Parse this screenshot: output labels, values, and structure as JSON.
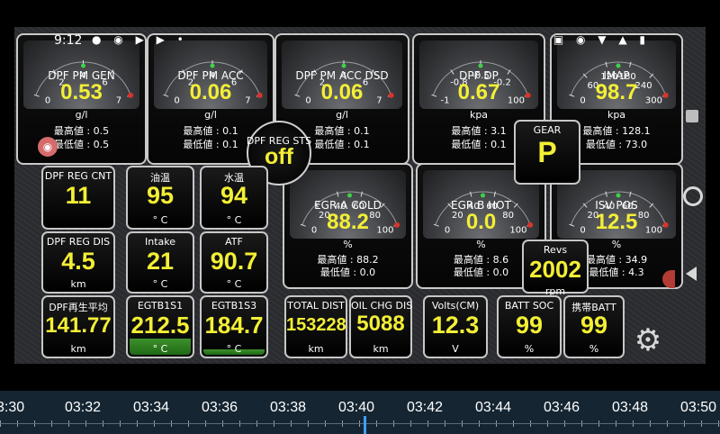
{
  "status_bar": {
    "time": "9:12"
  },
  "gauges": [
    {
      "id": "dpf-pm-gen",
      "title": "DPF PM GEN",
      "value": "0.53",
      "unit": "g/l",
      "ticks": [
        "0",
        "2",
        "4",
        "6",
        "7"
      ],
      "max_label": "最高値 : 0.5",
      "min_label": "最低値 : 0.5"
    },
    {
      "id": "dpf-pm-acc",
      "title": "DPF PM ACC",
      "value": "0.06",
      "unit": "g/l",
      "ticks": [
        "0",
        "2",
        "4",
        "6",
        "7"
      ],
      "max_label": "最高値 : 0.1",
      "min_label": "最低値 : 0.1"
    },
    {
      "id": "dpf-pm-acc-dsd",
      "title": "DPF PM ACC DSD",
      "value": "0.06",
      "unit": "g/l",
      "ticks": [
        "0",
        "2",
        "4",
        "6",
        "7"
      ],
      "max_label": "最高値 : 0.1",
      "min_label": "最低値 : 0.1"
    },
    {
      "id": "dpf-dp",
      "title": "DPF DP",
      "value": "0.67",
      "unit": "kpa",
      "ticks": [
        "-1",
        "-0.8",
        "-0.5",
        "-0.2",
        "100"
      ],
      "max_label": "最高値 : 3.1",
      "min_label": "最低値 : 0.1"
    },
    {
      "id": "imap",
      "title": "IMAP",
      "value": "98.7",
      "unit": "kpa",
      "ticks": [
        "0",
        "60",
        "120",
        "180",
        "240",
        "300"
      ],
      "max_label": "最高値 : 128.1",
      "min_label": "最低値 : 73.0"
    },
    {
      "id": "egr-a-cold",
      "title": "EGR A COLD",
      "value": "88.2",
      "unit": "%",
      "ticks": [
        "0",
        "20",
        "40",
        "60",
        "80",
        "100"
      ],
      "max_label": "最高値 : 88.2",
      "min_label": "最低値 : 0.0"
    },
    {
      "id": "egr-b-hot",
      "title": "EGR B HOT",
      "value": "0.0",
      "unit": "%",
      "ticks": [
        "0",
        "20",
        "40",
        "60",
        "80",
        "100"
      ],
      "max_label": "最高値 : 8.6",
      "min_label": "最低値 : 0.0"
    },
    {
      "id": "isv-pos",
      "title": "ISV POS",
      "value": "12.5",
      "unit": "%",
      "ticks": [
        "0",
        "20",
        "40",
        "60",
        "80",
        "100"
      ],
      "max_label": "最高値 : 34.9",
      "min_label": "最低値 : 4.3"
    }
  ],
  "tiles": [
    {
      "id": "dpf-reg-cnt",
      "label": "DPF REG CNT",
      "value": "11",
      "unit": ""
    },
    {
      "id": "oil-temp",
      "label": "油温",
      "value": "95",
      "unit": "° C"
    },
    {
      "id": "water-temp",
      "label": "水温",
      "value": "94",
      "unit": "° C"
    },
    {
      "id": "dpf-reg-dis",
      "label": "DPF REG DIS",
      "value": "4.5",
      "unit": "km"
    },
    {
      "id": "intake",
      "label": "Intake",
      "value": "21",
      "unit": "° C"
    },
    {
      "id": "atf",
      "label": "ATF",
      "value": "90.7",
      "unit": "° C"
    },
    {
      "id": "dpf-regen-avg",
      "label": "DPF再生平均",
      "value": "141.77",
      "unit": "km"
    },
    {
      "id": "egtb1s1",
      "label": "EGTB1S1",
      "value": "212.5",
      "unit": "° C"
    },
    {
      "id": "egtb1s3",
      "label": "EGTB1S3",
      "value": "184.7",
      "unit": "° C"
    },
    {
      "id": "total-dist",
      "label": "TOTAL DIST",
      "value": "153228",
      "unit": "km"
    },
    {
      "id": "oil-chg-dis",
      "label": "OIL CHG DIS",
      "value": "5088",
      "unit": "km"
    },
    {
      "id": "volts",
      "label": "Volts(CM)",
      "value": "12.3",
      "unit": "V"
    },
    {
      "id": "batt-soc",
      "label": "BATT SOC",
      "value": "99",
      "unit": "%"
    },
    {
      "id": "phone-batt",
      "label": "携帯BATT",
      "value": "99",
      "unit": "%"
    }
  ],
  "dpf_reg_sts": {
    "label": "DPF REG STS",
    "value": "off"
  },
  "gear": {
    "label": "GEAR",
    "value": "P"
  },
  "revs": {
    "label": "Revs",
    "value": "2002",
    "unit": "rpm"
  },
  "timeline": {
    "labels": [
      "3:30",
      "03:32",
      "03:34",
      "03:36",
      "03:38",
      "03:40",
      "03:42",
      "03:44",
      "03:46",
      "03:48",
      "03:50"
    ]
  },
  "colors": {
    "value": "#f3ef35",
    "bezel": "#c9c9c9",
    "timeline_bg": "#152532",
    "accent": "#3aa0ff"
  }
}
